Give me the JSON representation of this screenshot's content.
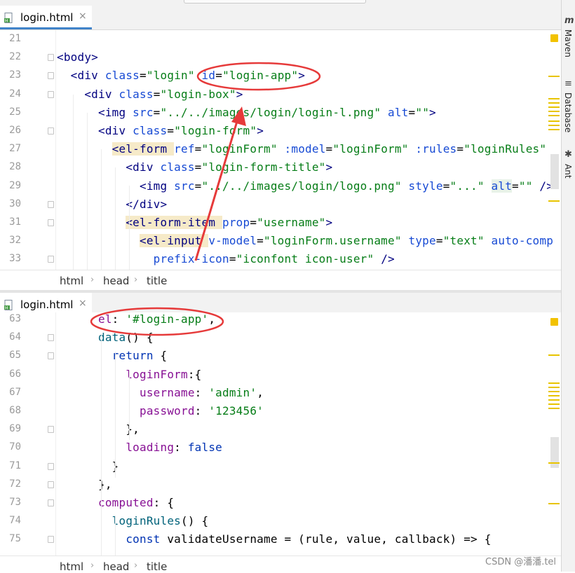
{
  "top_file_tab": {
    "name": "login.html",
    "close": "×"
  },
  "top_editor": {
    "lines": [
      {
        "n": "21",
        "tokens": []
      },
      {
        "n": "22",
        "tokens": [
          [
            "t-tag",
            "<body>"
          ]
        ]
      },
      {
        "n": "23",
        "tokens": [
          [
            "t-plain",
            "  "
          ],
          [
            "t-tag",
            "<div "
          ],
          [
            "t-attr",
            "class"
          ],
          [
            "t-plain",
            "="
          ],
          [
            "t-str",
            "\"login\""
          ],
          [
            "t-plain",
            " "
          ],
          [
            "t-attr",
            "id"
          ],
          [
            "t-plain",
            "="
          ],
          [
            "t-str",
            "\"login-app\""
          ],
          [
            "t-tag",
            ">"
          ]
        ]
      },
      {
        "n": "24",
        "tokens": [
          [
            "t-plain",
            "    "
          ],
          [
            "t-tag",
            "<div "
          ],
          [
            "t-attr",
            "class"
          ],
          [
            "t-plain",
            "="
          ],
          [
            "t-str",
            "\"login-box\""
          ],
          [
            "t-tag",
            ">"
          ]
        ]
      },
      {
        "n": "25",
        "tokens": [
          [
            "t-plain",
            "      "
          ],
          [
            "t-tag",
            "<img "
          ],
          [
            "t-attr",
            "src"
          ],
          [
            "t-plain",
            "="
          ],
          [
            "t-str",
            "\"../../images/login/login-l.png\""
          ],
          [
            "t-plain",
            " "
          ],
          [
            "t-attr",
            "alt"
          ],
          [
            "t-plain",
            "="
          ],
          [
            "t-str",
            "\"\""
          ],
          [
            "t-tag",
            ">"
          ]
        ]
      },
      {
        "n": "26",
        "tokens": [
          [
            "t-plain",
            "      "
          ],
          [
            "t-tag",
            "<div "
          ],
          [
            "t-attr",
            "class"
          ],
          [
            "t-plain",
            "="
          ],
          [
            "t-str",
            "\"login-form\""
          ],
          [
            "t-tag",
            ">"
          ]
        ]
      },
      {
        "n": "27",
        "tokens": [
          [
            "t-plain",
            "        "
          ],
          [
            "t-tag",
            "<el-form "
          ],
          [
            "t-attr",
            "ref"
          ],
          [
            "t-plain",
            "="
          ],
          [
            "t-str",
            "\"loginForm\""
          ],
          [
            "t-plain",
            " "
          ],
          [
            "t-attr",
            ":model"
          ],
          [
            "t-plain",
            "="
          ],
          [
            "t-str",
            "\"loginForm\""
          ],
          [
            "t-plain",
            " "
          ],
          [
            "t-attr",
            ":rules"
          ],
          [
            "t-plain",
            "="
          ],
          [
            "t-str",
            "\"loginRules\""
          ]
        ]
      },
      {
        "n": "28",
        "tokens": [
          [
            "t-plain",
            "          "
          ],
          [
            "t-tag",
            "<div "
          ],
          [
            "t-attr",
            "class"
          ],
          [
            "t-plain",
            "="
          ],
          [
            "t-str",
            "\"login-form-title\""
          ],
          [
            "t-tag",
            ">"
          ]
        ]
      },
      {
        "n": "29",
        "tokens": [
          [
            "t-plain",
            "            "
          ],
          [
            "t-tag",
            "<img "
          ],
          [
            "t-attr",
            "src"
          ],
          [
            "t-plain",
            "="
          ],
          [
            "t-str",
            "\"../../images/login/logo.png\""
          ],
          [
            "t-plain",
            " "
          ],
          [
            "t-attr",
            "style"
          ],
          [
            "t-plain",
            "="
          ],
          [
            "t-str",
            "\"...\""
          ],
          [
            "t-plain",
            " "
          ],
          [
            "t-attr",
            "alt"
          ],
          [
            "t-plain",
            "="
          ],
          [
            "t-str",
            "\"\""
          ],
          [
            "t-plain",
            " "
          ],
          [
            "t-tag",
            "/>"
          ]
        ]
      },
      {
        "n": "30",
        "tokens": [
          [
            "t-plain",
            "          "
          ],
          [
            "t-tag",
            "</div>"
          ]
        ]
      },
      {
        "n": "31",
        "tokens": [
          [
            "t-plain",
            "          "
          ],
          [
            "t-tag",
            "<el-form-item "
          ],
          [
            "t-attr",
            "prop"
          ],
          [
            "t-plain",
            "="
          ],
          [
            "t-str",
            "\"username\""
          ],
          [
            "t-tag",
            ">"
          ]
        ]
      },
      {
        "n": "32",
        "tokens": [
          [
            "t-plain",
            "            "
          ],
          [
            "t-tag",
            "<el-input "
          ],
          [
            "t-attr",
            "v-model"
          ],
          [
            "t-plain",
            "="
          ],
          [
            "t-str",
            "\"loginForm.username\""
          ],
          [
            "t-plain",
            " "
          ],
          [
            "t-attr",
            "type"
          ],
          [
            "t-plain",
            "="
          ],
          [
            "t-str",
            "\"text\""
          ],
          [
            "t-plain",
            " "
          ],
          [
            "t-attr",
            "auto-comp"
          ]
        ]
      },
      {
        "n": "33",
        "tokens": [
          [
            "t-plain",
            "              "
          ],
          [
            "t-attr",
            "prefix-icon"
          ],
          [
            "t-plain",
            "="
          ],
          [
            "t-str",
            "\"iconfont icon-user\""
          ],
          [
            "t-plain",
            " "
          ],
          [
            "t-tag",
            "/>"
          ]
        ]
      }
    ]
  },
  "top_breadcrumb": [
    "html",
    "head",
    "title"
  ],
  "bottom_file_tab": {
    "name": "login.html",
    "close": "×"
  },
  "bottom_editor": {
    "lines": [
      {
        "n": "63",
        "tokens": [
          [
            "t-plain",
            "      "
          ],
          [
            "t-key",
            "el"
          ],
          [
            "t-plain",
            ": "
          ],
          [
            "t-str",
            "'#login-app'"
          ],
          [
            "t-plain",
            ","
          ]
        ]
      },
      {
        "n": "64",
        "tokens": [
          [
            "t-plain",
            "      "
          ],
          [
            "t-fn",
            "data"
          ],
          [
            "t-plain",
            "() {"
          ]
        ]
      },
      {
        "n": "65",
        "tokens": [
          [
            "t-plain",
            "        "
          ],
          [
            "t-kw",
            "return"
          ],
          [
            "t-plain",
            " {"
          ]
        ]
      },
      {
        "n": "66",
        "tokens": [
          [
            "t-plain",
            "          "
          ],
          [
            "t-key",
            "loginForm"
          ],
          [
            "t-plain",
            ":{"
          ]
        ]
      },
      {
        "n": "67",
        "tokens": [
          [
            "t-plain",
            "            "
          ],
          [
            "t-key",
            "username"
          ],
          [
            "t-plain",
            ": "
          ],
          [
            "t-str",
            "'admin'"
          ],
          [
            "t-plain",
            ","
          ]
        ]
      },
      {
        "n": "68",
        "tokens": [
          [
            "t-plain",
            "            "
          ],
          [
            "t-key",
            "password"
          ],
          [
            "t-plain",
            ": "
          ],
          [
            "t-str",
            "'123456'"
          ]
        ]
      },
      {
        "n": "69",
        "tokens": [
          [
            "t-plain",
            "          },"
          ]
        ]
      },
      {
        "n": "70",
        "tokens": [
          [
            "t-plain",
            "          "
          ],
          [
            "t-key",
            "loading"
          ],
          [
            "t-plain",
            ": "
          ],
          [
            "t-kw",
            "false"
          ]
        ]
      },
      {
        "n": "71",
        "tokens": [
          [
            "t-plain",
            "        }"
          ]
        ]
      },
      {
        "n": "72",
        "tokens": [
          [
            "t-plain",
            "      },"
          ]
        ]
      },
      {
        "n": "73",
        "tokens": [
          [
            "t-plain",
            "      "
          ],
          [
            "t-key",
            "computed"
          ],
          [
            "t-plain",
            ": {"
          ]
        ]
      },
      {
        "n": "74",
        "tokens": [
          [
            "t-plain",
            "        "
          ],
          [
            "t-fn",
            "loginRules"
          ],
          [
            "t-plain",
            "() {"
          ]
        ]
      },
      {
        "n": "75",
        "tokens": [
          [
            "t-plain",
            "          "
          ],
          [
            "t-kw",
            "const"
          ],
          [
            "t-plain",
            " "
          ],
          [
            "t-var",
            "validateUsername"
          ],
          [
            "t-plain",
            " = ("
          ],
          [
            "t-var",
            "rule"
          ],
          [
            "t-plain",
            ", "
          ],
          [
            "t-var",
            "value"
          ],
          [
            "t-plain",
            ", "
          ],
          [
            "t-var",
            "callback"
          ],
          [
            "t-plain",
            ") => {"
          ]
        ]
      }
    ]
  },
  "bottom_breadcrumb": [
    "html",
    "head",
    "title"
  ],
  "right_toolbar": {
    "items": [
      {
        "label": "Maven",
        "icon": "m"
      },
      {
        "label": "Database",
        "icon": "≡"
      },
      {
        "label": "Ant",
        "icon": "✱"
      }
    ]
  },
  "colors": {
    "annotation": "#e63a3a",
    "accent": "#4083c9",
    "marker": "#e8c400"
  },
  "watermark": "CSDN @潘潘.tel"
}
